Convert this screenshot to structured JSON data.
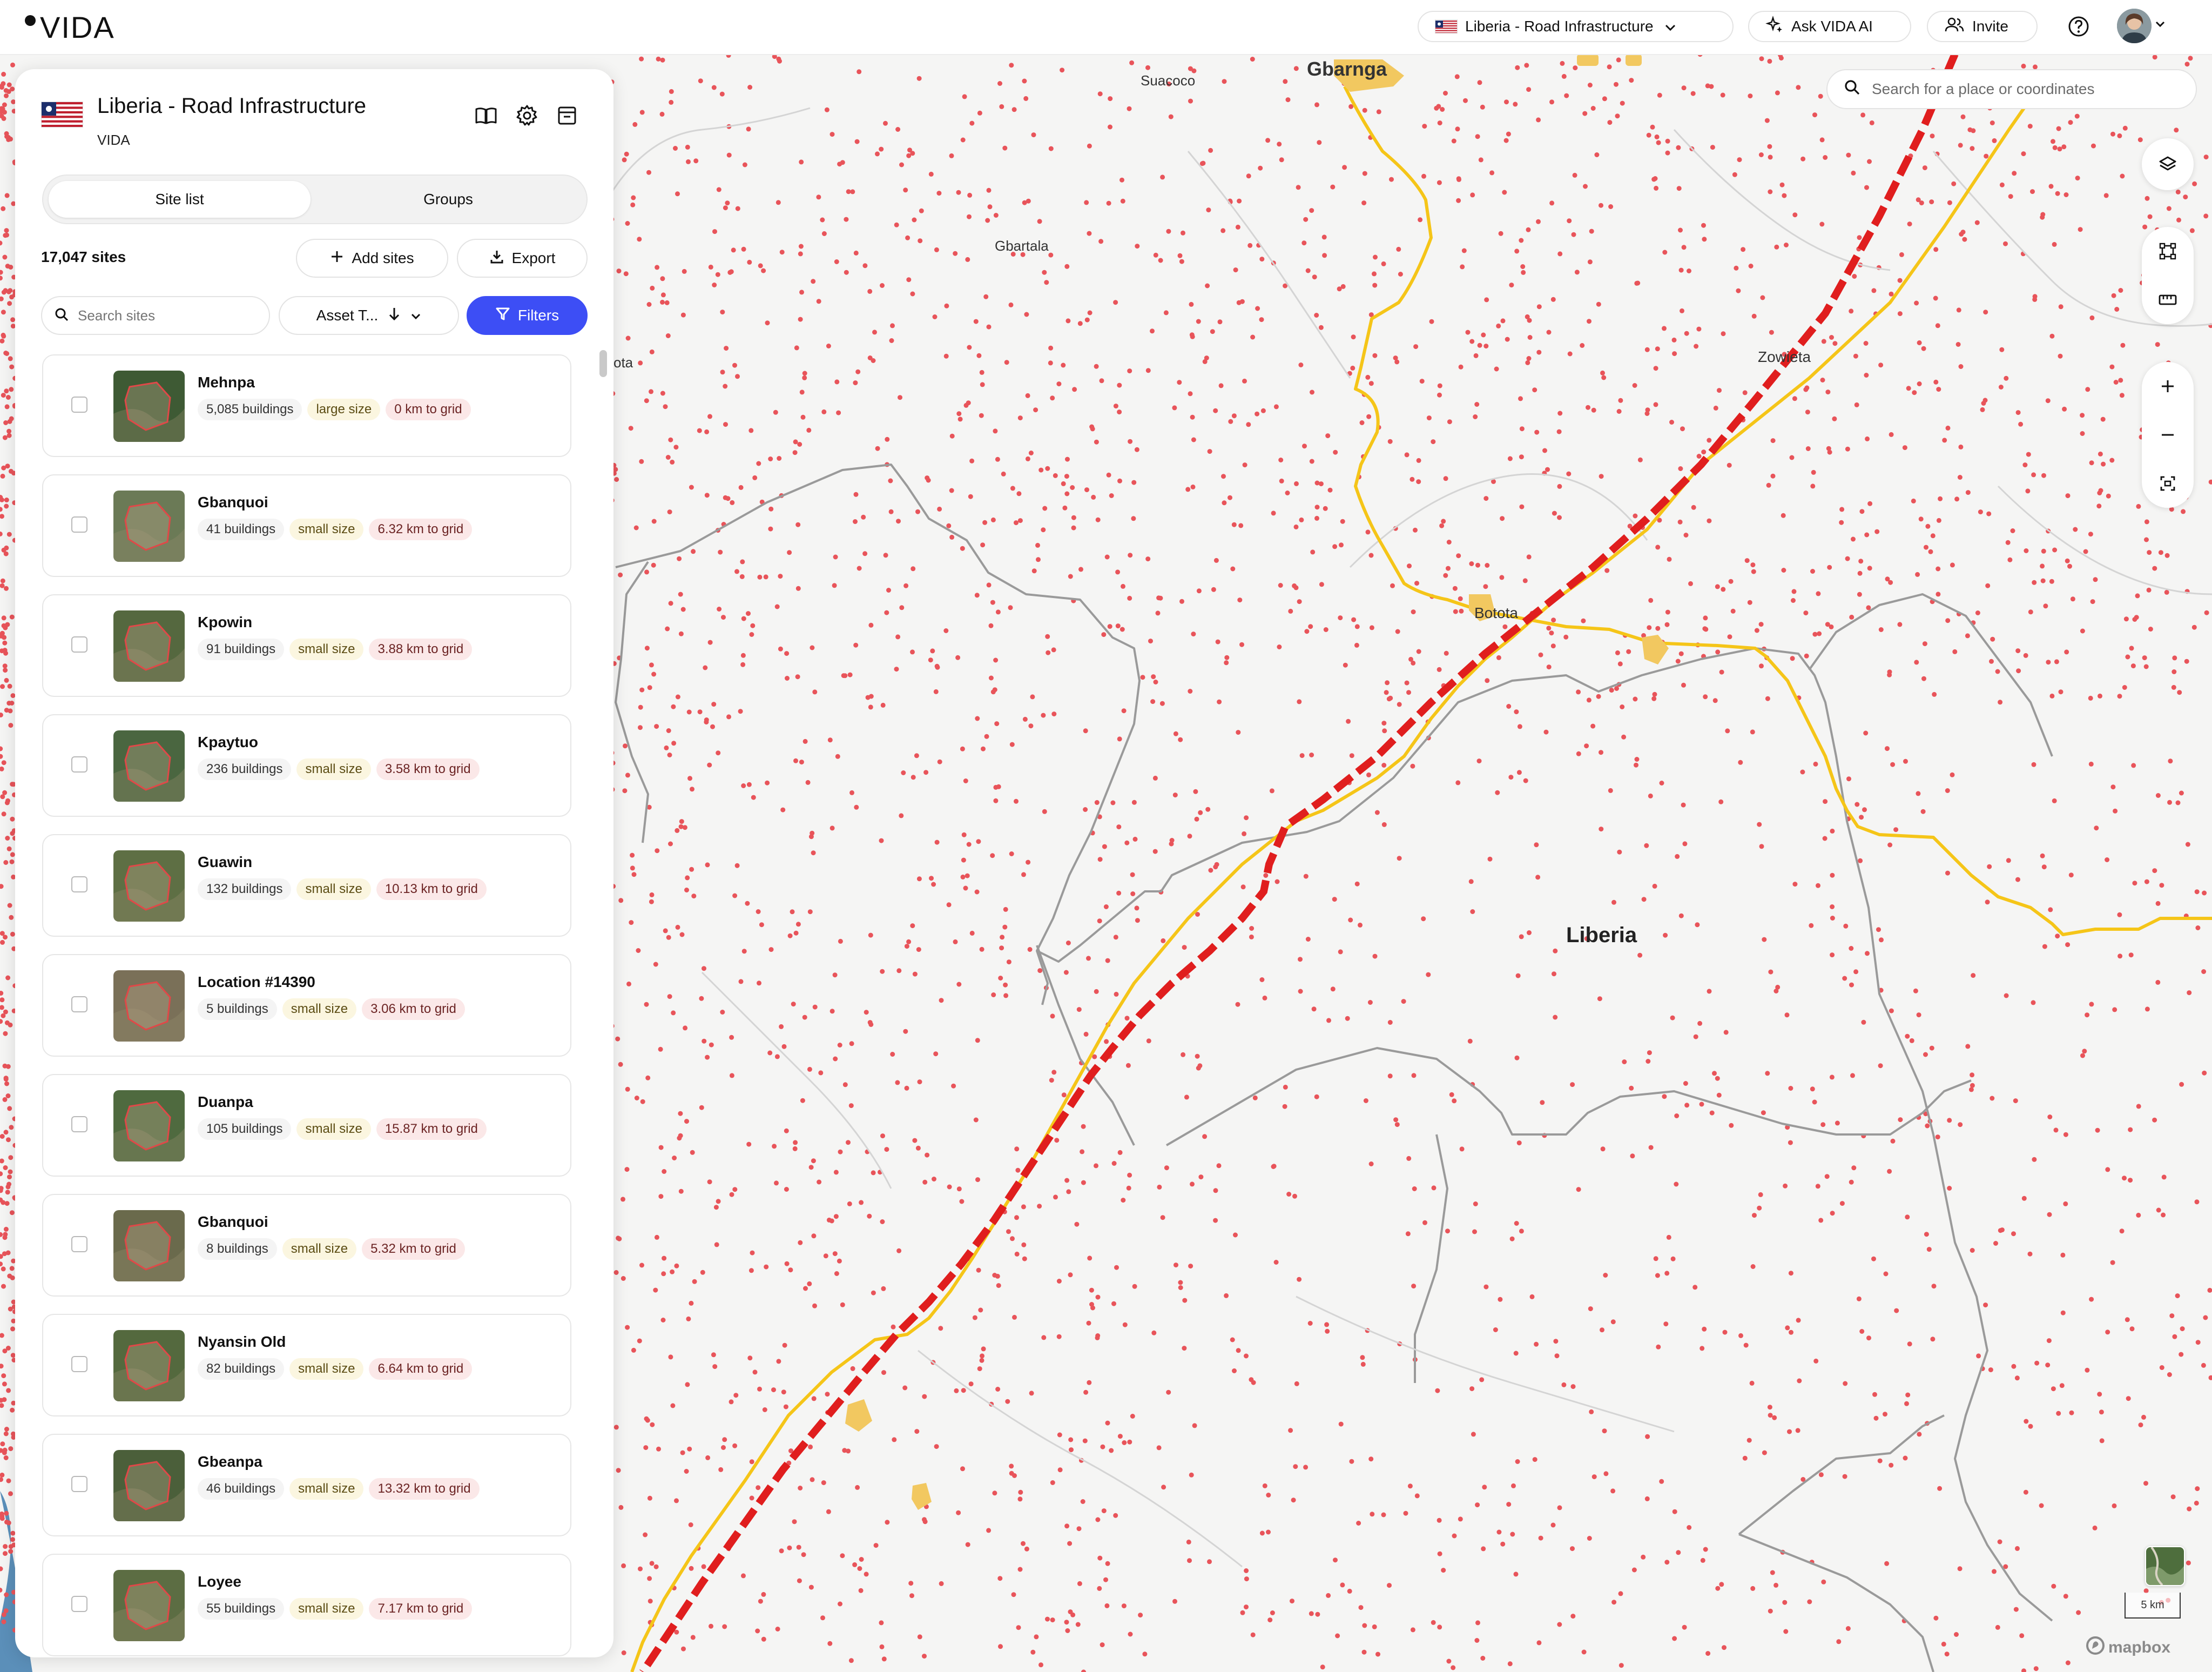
{
  "app": {
    "logo_text": "VIDA"
  },
  "topbar": {
    "project_label": "Liberia - Road Infrastructure",
    "ask_ai_label": "Ask VIDA AI",
    "invite_label": "Invite"
  },
  "panel": {
    "title": "Liberia - Road Infrastructure",
    "org": "VIDA",
    "tabs": [
      "Site list",
      "Groups"
    ],
    "active_tab": "Site list",
    "site_count": "17,047 sites",
    "add_sites_label": "Add sites",
    "export_label": "Export",
    "search_placeholder": "Search sites",
    "sort_label": "Asset T...",
    "filters_label": "Filters"
  },
  "sites": [
    {
      "name": "Mehnpa",
      "buildings": "5,085 buildings",
      "size": "large size",
      "grid": "0 km to grid"
    },
    {
      "name": "Gbanquoi",
      "buildings": "41 buildings",
      "size": "small size",
      "grid": "6.32 km to grid"
    },
    {
      "name": "Kpowin",
      "buildings": "91 buildings",
      "size": "small size",
      "grid": "3.88 km to grid"
    },
    {
      "name": "Kpaytuo",
      "buildings": "236 buildings",
      "size": "small size",
      "grid": "3.58 km to grid"
    },
    {
      "name": "Guawin",
      "buildings": "132 buildings",
      "size": "small size",
      "grid": "10.13 km to grid"
    },
    {
      "name": "Location #14390",
      "buildings": "5 buildings",
      "size": "small size",
      "grid": "3.06 km to grid"
    },
    {
      "name": "Duanpa",
      "buildings": "105 buildings",
      "size": "small size",
      "grid": "15.87 km to grid"
    },
    {
      "name": "Gbanquoi",
      "buildings": "8 buildings",
      "size": "small size",
      "grid": "5.32 km to grid"
    },
    {
      "name": "Nyansin Old",
      "buildings": "82 buildings",
      "size": "small size",
      "grid": "6.64 km to grid"
    },
    {
      "name": "Gbeanpa",
      "buildings": "46 buildings",
      "size": "small size",
      "grid": "13.32 km to grid"
    },
    {
      "name": "Loyee",
      "buildings": "55 buildings",
      "size": "small size",
      "grid": "7.17 km to grid"
    }
  ],
  "map": {
    "search_placeholder": "Search for a place or coordinates",
    "labels": {
      "gbarnga": "Gbarnga",
      "suacoco": "Suacoco",
      "gbartala": "Gbartala",
      "zowieta": "Zowieta",
      "botota": "Botota",
      "liberia": "Liberia",
      "edge": "ota"
    },
    "scale_label": "5 km",
    "attribution": "mapbox"
  },
  "colors": {
    "accent": "#3d4ef5",
    "road_main": "#e01e1e",
    "road_secondary": "#f5c518",
    "site_dot": "#e8545a",
    "map_bg": "#f5f5f4"
  }
}
